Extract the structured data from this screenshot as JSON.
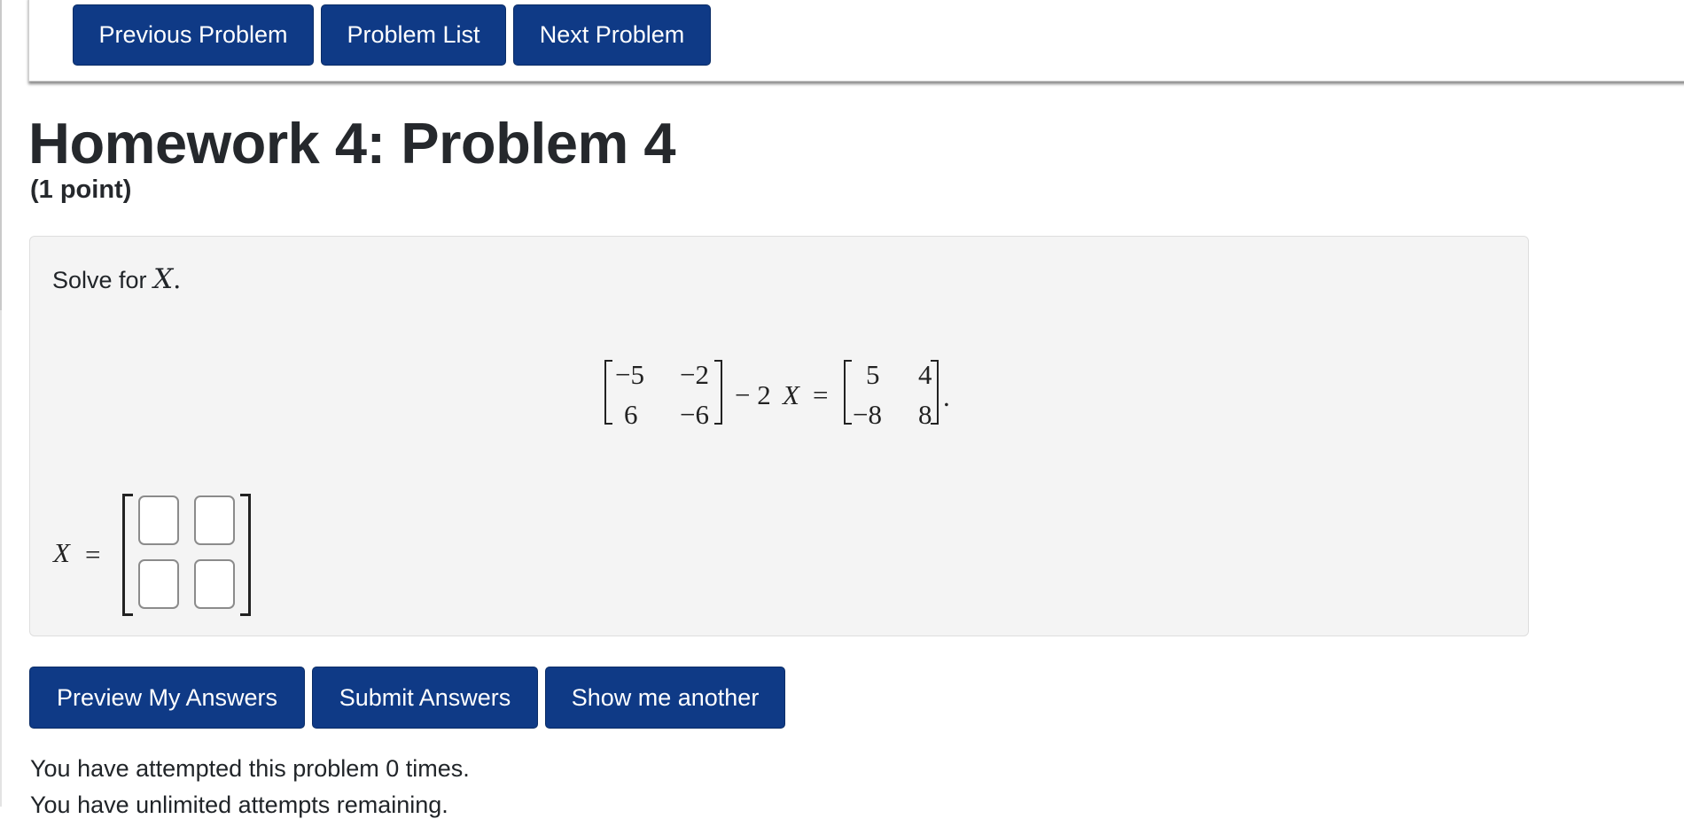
{
  "nav": {
    "previous_label": "Previous Problem",
    "list_label": "Problem List",
    "next_label": "Next Problem"
  },
  "header": {
    "title": "Homework 4: Problem 4",
    "points": "(1 point)"
  },
  "problem": {
    "prompt_text": "Solve for ",
    "prompt_var": "X",
    "prompt_end": ".",
    "equation": {
      "matrix_a": [
        [
          "−5",
          "−2"
        ],
        [
          "6",
          "−6"
        ]
      ],
      "operator": "− 2",
      "variable": "X",
      "equals": "=",
      "matrix_b": [
        [
          "5",
          "4"
        ],
        [
          "−8",
          "8"
        ]
      ],
      "end": "."
    },
    "answer": {
      "variable": "X",
      "equals": "=",
      "cells": [
        [
          "",
          ""
        ],
        [
          "",
          ""
        ]
      ]
    }
  },
  "actions": {
    "preview_label": "Preview My Answers",
    "submit_label": "Submit Answers",
    "another_label": "Show me another"
  },
  "status": {
    "attempts": "You have attempted this problem 0 times.",
    "remaining": "You have unlimited attempts remaining."
  },
  "colors": {
    "button_bg": "#0f3a86",
    "panel_bg": "#f4f4f4"
  }
}
